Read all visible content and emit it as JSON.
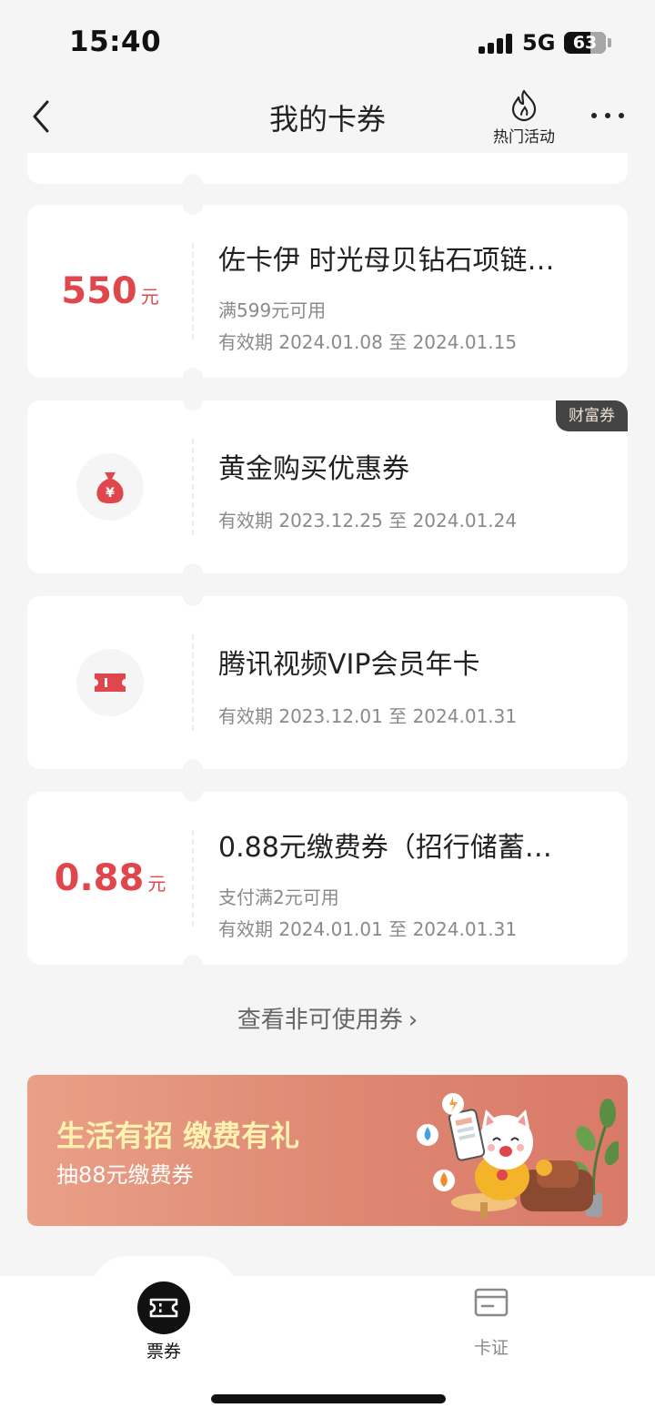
{
  "status_bar": {
    "time": "15:40",
    "network": "5G",
    "battery": "63"
  },
  "nav": {
    "title": "我的卡券",
    "hot_label": "热门活动",
    "back_icon": "chevron-left-icon",
    "more_icon": "more-dots-icon",
    "hot_icon": "flame-icon"
  },
  "coupons": [
    {
      "amount": "550",
      "unit": "元",
      "title": "佐卡伊 时光母贝钻石项链…",
      "condition": "满599元可用",
      "validity": "有效期 2024.01.08 至 2024.01.15"
    },
    {
      "icon": "money-bag-icon",
      "title": "黄金购买优惠券",
      "validity": "有效期 2023.12.25 至 2024.01.24",
      "badge": "财富券"
    },
    {
      "icon": "ticket-icon",
      "title": "腾讯视频VIP会员年卡",
      "validity": "有效期 2023.12.01 至 2024.01.31"
    },
    {
      "amount": "0.88",
      "unit": "元",
      "title": "0.88元缴费券（招行储蓄…",
      "condition": "支付满2元可用",
      "validity": "有效期 2024.01.01 至 2024.01.31"
    }
  ],
  "more_link": "查看非可使用券",
  "banner": {
    "title": "生活有招 缴费有礼",
    "subtitle": "抽88元缴费券"
  },
  "tabs": [
    {
      "label": "票券",
      "icon": "ticket-icon",
      "active": true
    },
    {
      "label": "卡证",
      "icon": "card-icon",
      "active": false
    }
  ],
  "colors": {
    "accent": "#e0474c",
    "background": "#f5f5f6",
    "badge_bg": "#444444",
    "banner_title": "#fff2b0"
  }
}
